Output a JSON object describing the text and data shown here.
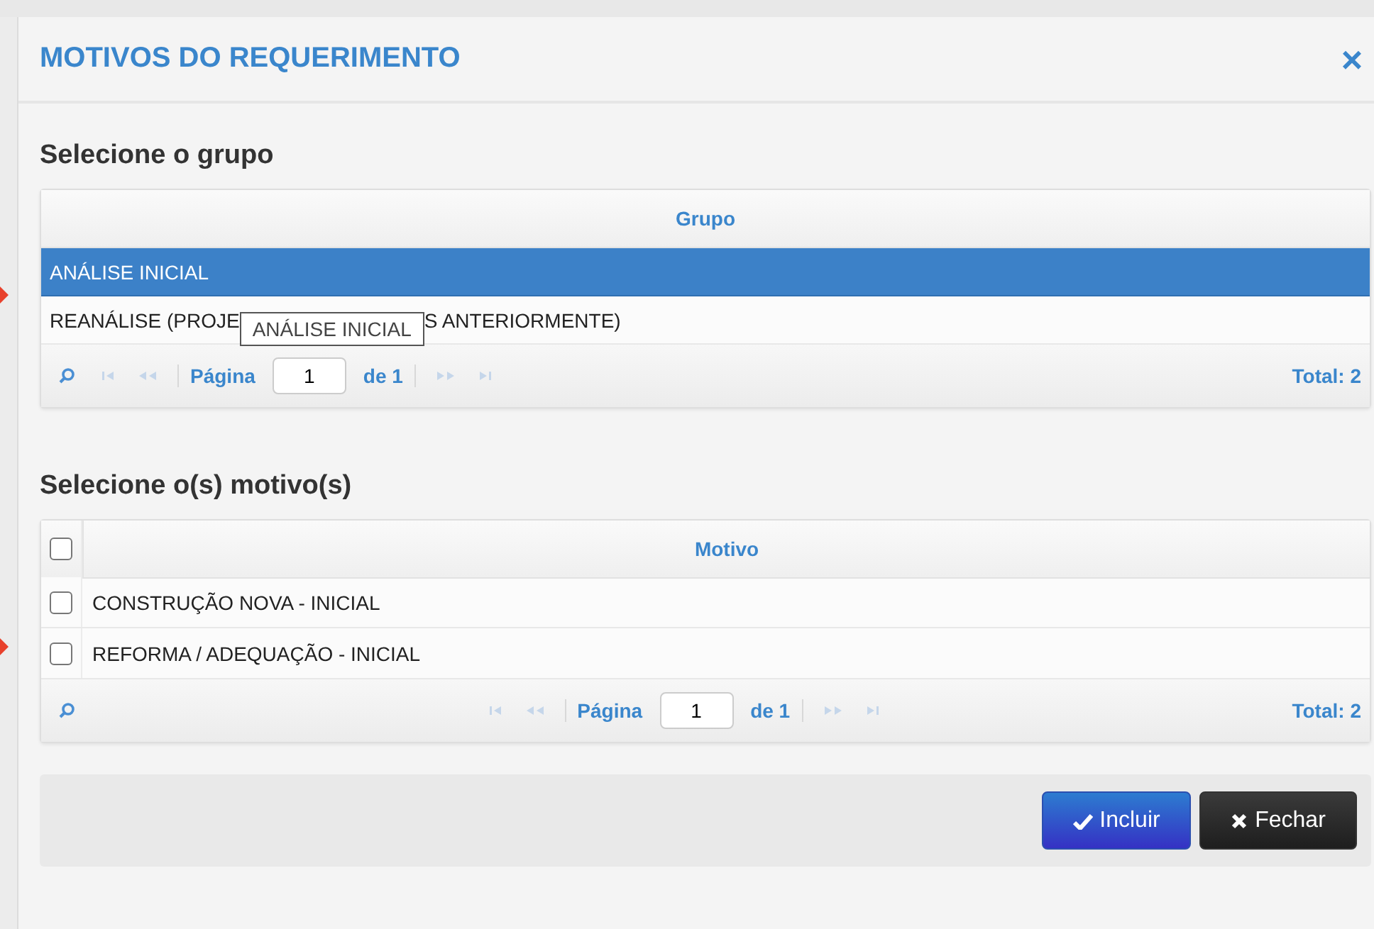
{
  "dialog": {
    "title": "MOTIVOS DO REQUERIMENTO",
    "close": "×"
  },
  "group_section": {
    "heading": "Selecione o grupo",
    "column": "Grupo",
    "rows": [
      {
        "text": "ANÁLISE INICIAL",
        "selected": true
      },
      {
        "text": "REANÁLISE (PROJE",
        "text_after": "S ANTERIORMENTE)",
        "selected": false,
        "tooltip": "ANÁLISE INICIAL"
      }
    ],
    "pager": {
      "page_label": "Página",
      "page": "1",
      "of": "de 1",
      "total": "Total: 2"
    }
  },
  "reason_section": {
    "heading": "Selecione o(s) motivo(s)",
    "column": "Motivo",
    "all_checked": false,
    "rows": [
      {
        "text": "CONSTRUÇÃO NOVA - INICIAL",
        "checked": false
      },
      {
        "text": "REFORMA / ADEQUAÇÃO - INICIAL",
        "checked": false
      }
    ],
    "pager": {
      "page_label": "Página",
      "page": "1",
      "of": "de 1",
      "total": "Total: 2"
    }
  },
  "buttons": [
    {
      "kind": "confirm",
      "label": "Incluir"
    },
    {
      "kind": "close",
      "label": "Fechar"
    }
  ]
}
